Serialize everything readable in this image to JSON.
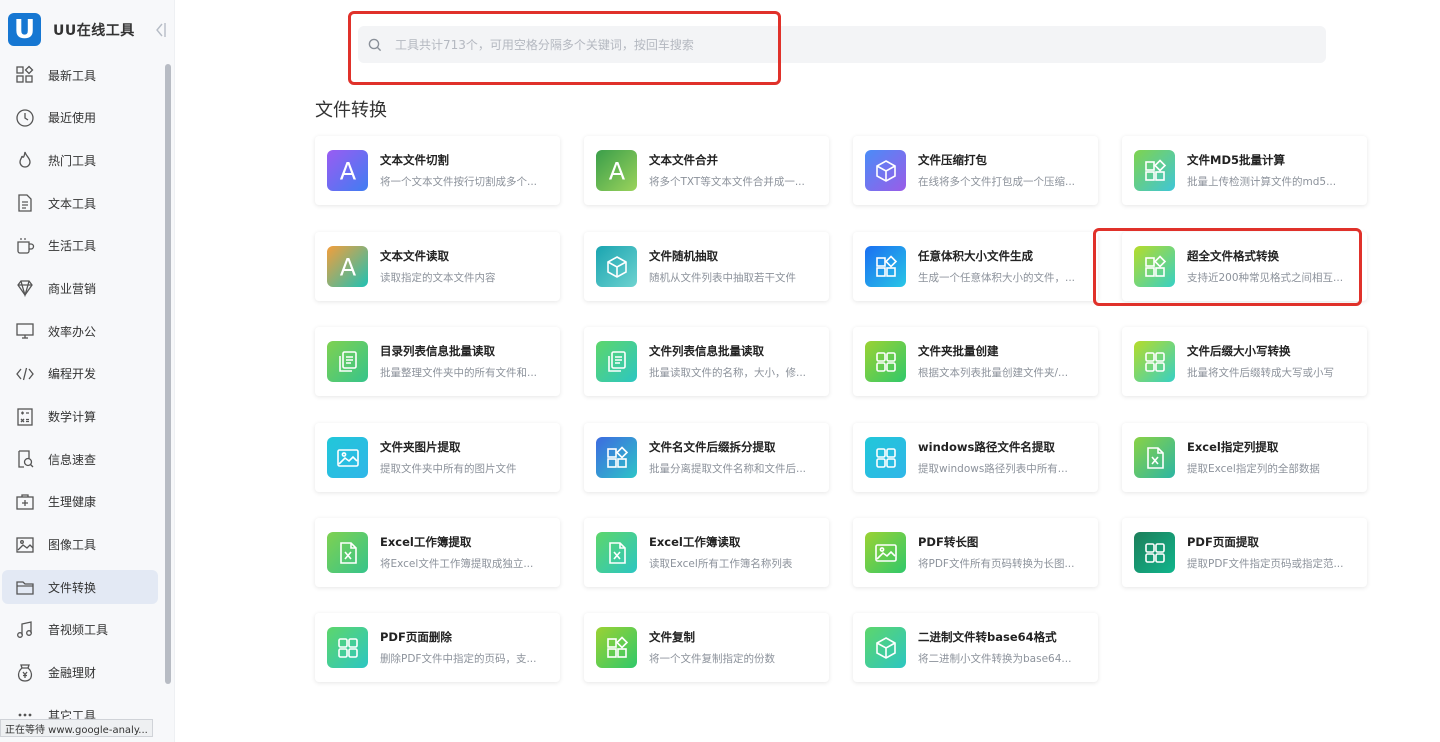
{
  "app": {
    "logo_letter": "U",
    "name": "UU在线工具"
  },
  "search": {
    "placeholder": "工具共计713个，可用空格分隔多个关键词，按回车搜索",
    "value": ""
  },
  "sidebar": {
    "items": [
      {
        "label": "最新工具",
        "icon": "grid-plus-icon"
      },
      {
        "label": "最近使用",
        "icon": "clock-icon"
      },
      {
        "label": "热门工具",
        "icon": "fire-icon"
      },
      {
        "label": "文本工具",
        "icon": "document-icon"
      },
      {
        "label": "生活工具",
        "icon": "mug-icon"
      },
      {
        "label": "商业营销",
        "icon": "diamond-icon"
      },
      {
        "label": "效率办公",
        "icon": "monitor-icon"
      },
      {
        "label": "编程开发",
        "icon": "code-icon"
      },
      {
        "label": "数学计算",
        "icon": "calculator-icon"
      },
      {
        "label": "信息速查",
        "icon": "search-doc-icon"
      },
      {
        "label": "生理健康",
        "icon": "medkit-icon"
      },
      {
        "label": "图像工具",
        "icon": "image-icon"
      },
      {
        "label": "文件转换",
        "icon": "folder-icon",
        "active": true
      },
      {
        "label": "音视频工具",
        "icon": "music-icon"
      },
      {
        "label": "金融理财",
        "icon": "money-bag-icon"
      },
      {
        "label": "其它工具",
        "icon": "more-icon"
      }
    ]
  },
  "status": "正在等待 www.google-analy...",
  "section_title": "文件转换",
  "tools": [
    {
      "title": "文本文件切割",
      "desc": "将一个文本文件按行切割成多个...",
      "icon": "letter-a-icon",
      "grad": "g-purple"
    },
    {
      "title": "文本文件合并",
      "desc": "将多个TXT等文本文件合并成一...",
      "icon": "letter-a-icon",
      "grad": "g-green"
    },
    {
      "title": "文件压缩打包",
      "desc": "在线将多个文件打包成一个压缩...",
      "icon": "cube-icon",
      "grad": "g-violet"
    },
    {
      "title": "文件MD5批量计算",
      "desc": "批量上传检测计算文件的md5...",
      "icon": "apps-icon",
      "grad": "g-lime"
    },
    {
      "title": "文本文件读取",
      "desc": "读取指定的文本文件内容",
      "icon": "letter-a-icon",
      "grad": "g-orange"
    },
    {
      "title": "文件随机抽取",
      "desc": "随机从文件列表中抽取若干文件",
      "icon": "cube-icon",
      "grad": "g-teal"
    },
    {
      "title": "任意体积大小文件生成",
      "desc": "生成一个任意体积大小的文件，...",
      "icon": "apps-icon",
      "grad": "g-blue"
    },
    {
      "title": "超全文件格式转换",
      "desc": "支持近200种常见格式之间相互...",
      "icon": "apps-icon",
      "grad": "g-limey"
    },
    {
      "title": "目录列表信息批量读取",
      "desc": "批量整理文件夹中的所有文件和...",
      "icon": "files-icon",
      "grad": "g-gl"
    },
    {
      "title": "文件列表信息批量读取",
      "desc": "批量读取文件的名称，大小，修...",
      "icon": "files-icon",
      "grad": "g-mint"
    },
    {
      "title": "文件夹批量创建",
      "desc": "根据文本列表批量创建文件夹/...",
      "icon": "grid-icon",
      "grad": "g-yg"
    },
    {
      "title": "文件后缀大小写转换",
      "desc": "批量将文件后缀转成大写或小写",
      "icon": "grid-icon",
      "grad": "g-limey"
    },
    {
      "title": "文件夹图片提取",
      "desc": "提取文件夹中所有的图片文件",
      "icon": "picture-icon",
      "grad": "g-cyan"
    },
    {
      "title": "文件名文件后缀拆分提取",
      "desc": "批量分离提取文件名称和文件后...",
      "icon": "apps-icon",
      "grad": "g-indigo"
    },
    {
      "title": "windows路径文件名提取",
      "desc": "提取windows路径列表中所有...",
      "icon": "grid-icon",
      "grad": "g-cyan"
    },
    {
      "title": "Excel指定列提取",
      "desc": "提取Excel指定列的全部数据",
      "icon": "excel-icon",
      "grad": "g-ex"
    },
    {
      "title": "Excel工作簿提取",
      "desc": "将Excel文件工作簿提取成独立...",
      "icon": "excel-icon",
      "grad": "g-gl"
    },
    {
      "title": "Excel工作簿读取",
      "desc": "读取Excel所有工作簿名称列表",
      "icon": "excel-icon",
      "grad": "g-mint"
    },
    {
      "title": "PDF转长图",
      "desc": "将PDF文件所有页码转换为长图...",
      "icon": "picture-icon",
      "grad": "g-yg"
    },
    {
      "title": "PDF页面提取",
      "desc": "提取PDF文件指定页码或指定范...",
      "icon": "grid-icon",
      "grad": "g-dark"
    },
    {
      "title": "PDF页面删除",
      "desc": "删除PDF文件中指定的页码，支...",
      "icon": "grid-icon",
      "grad": "g-mint"
    },
    {
      "title": "文件复制",
      "desc": "将一个文件复制指定的份数",
      "icon": "apps-icon",
      "grad": "g-yg"
    },
    {
      "title": "二进制文件转base64格式",
      "desc": "将二进制小文件转换为base64...",
      "icon": "cube-icon",
      "grad": "g-mint"
    }
  ]
}
